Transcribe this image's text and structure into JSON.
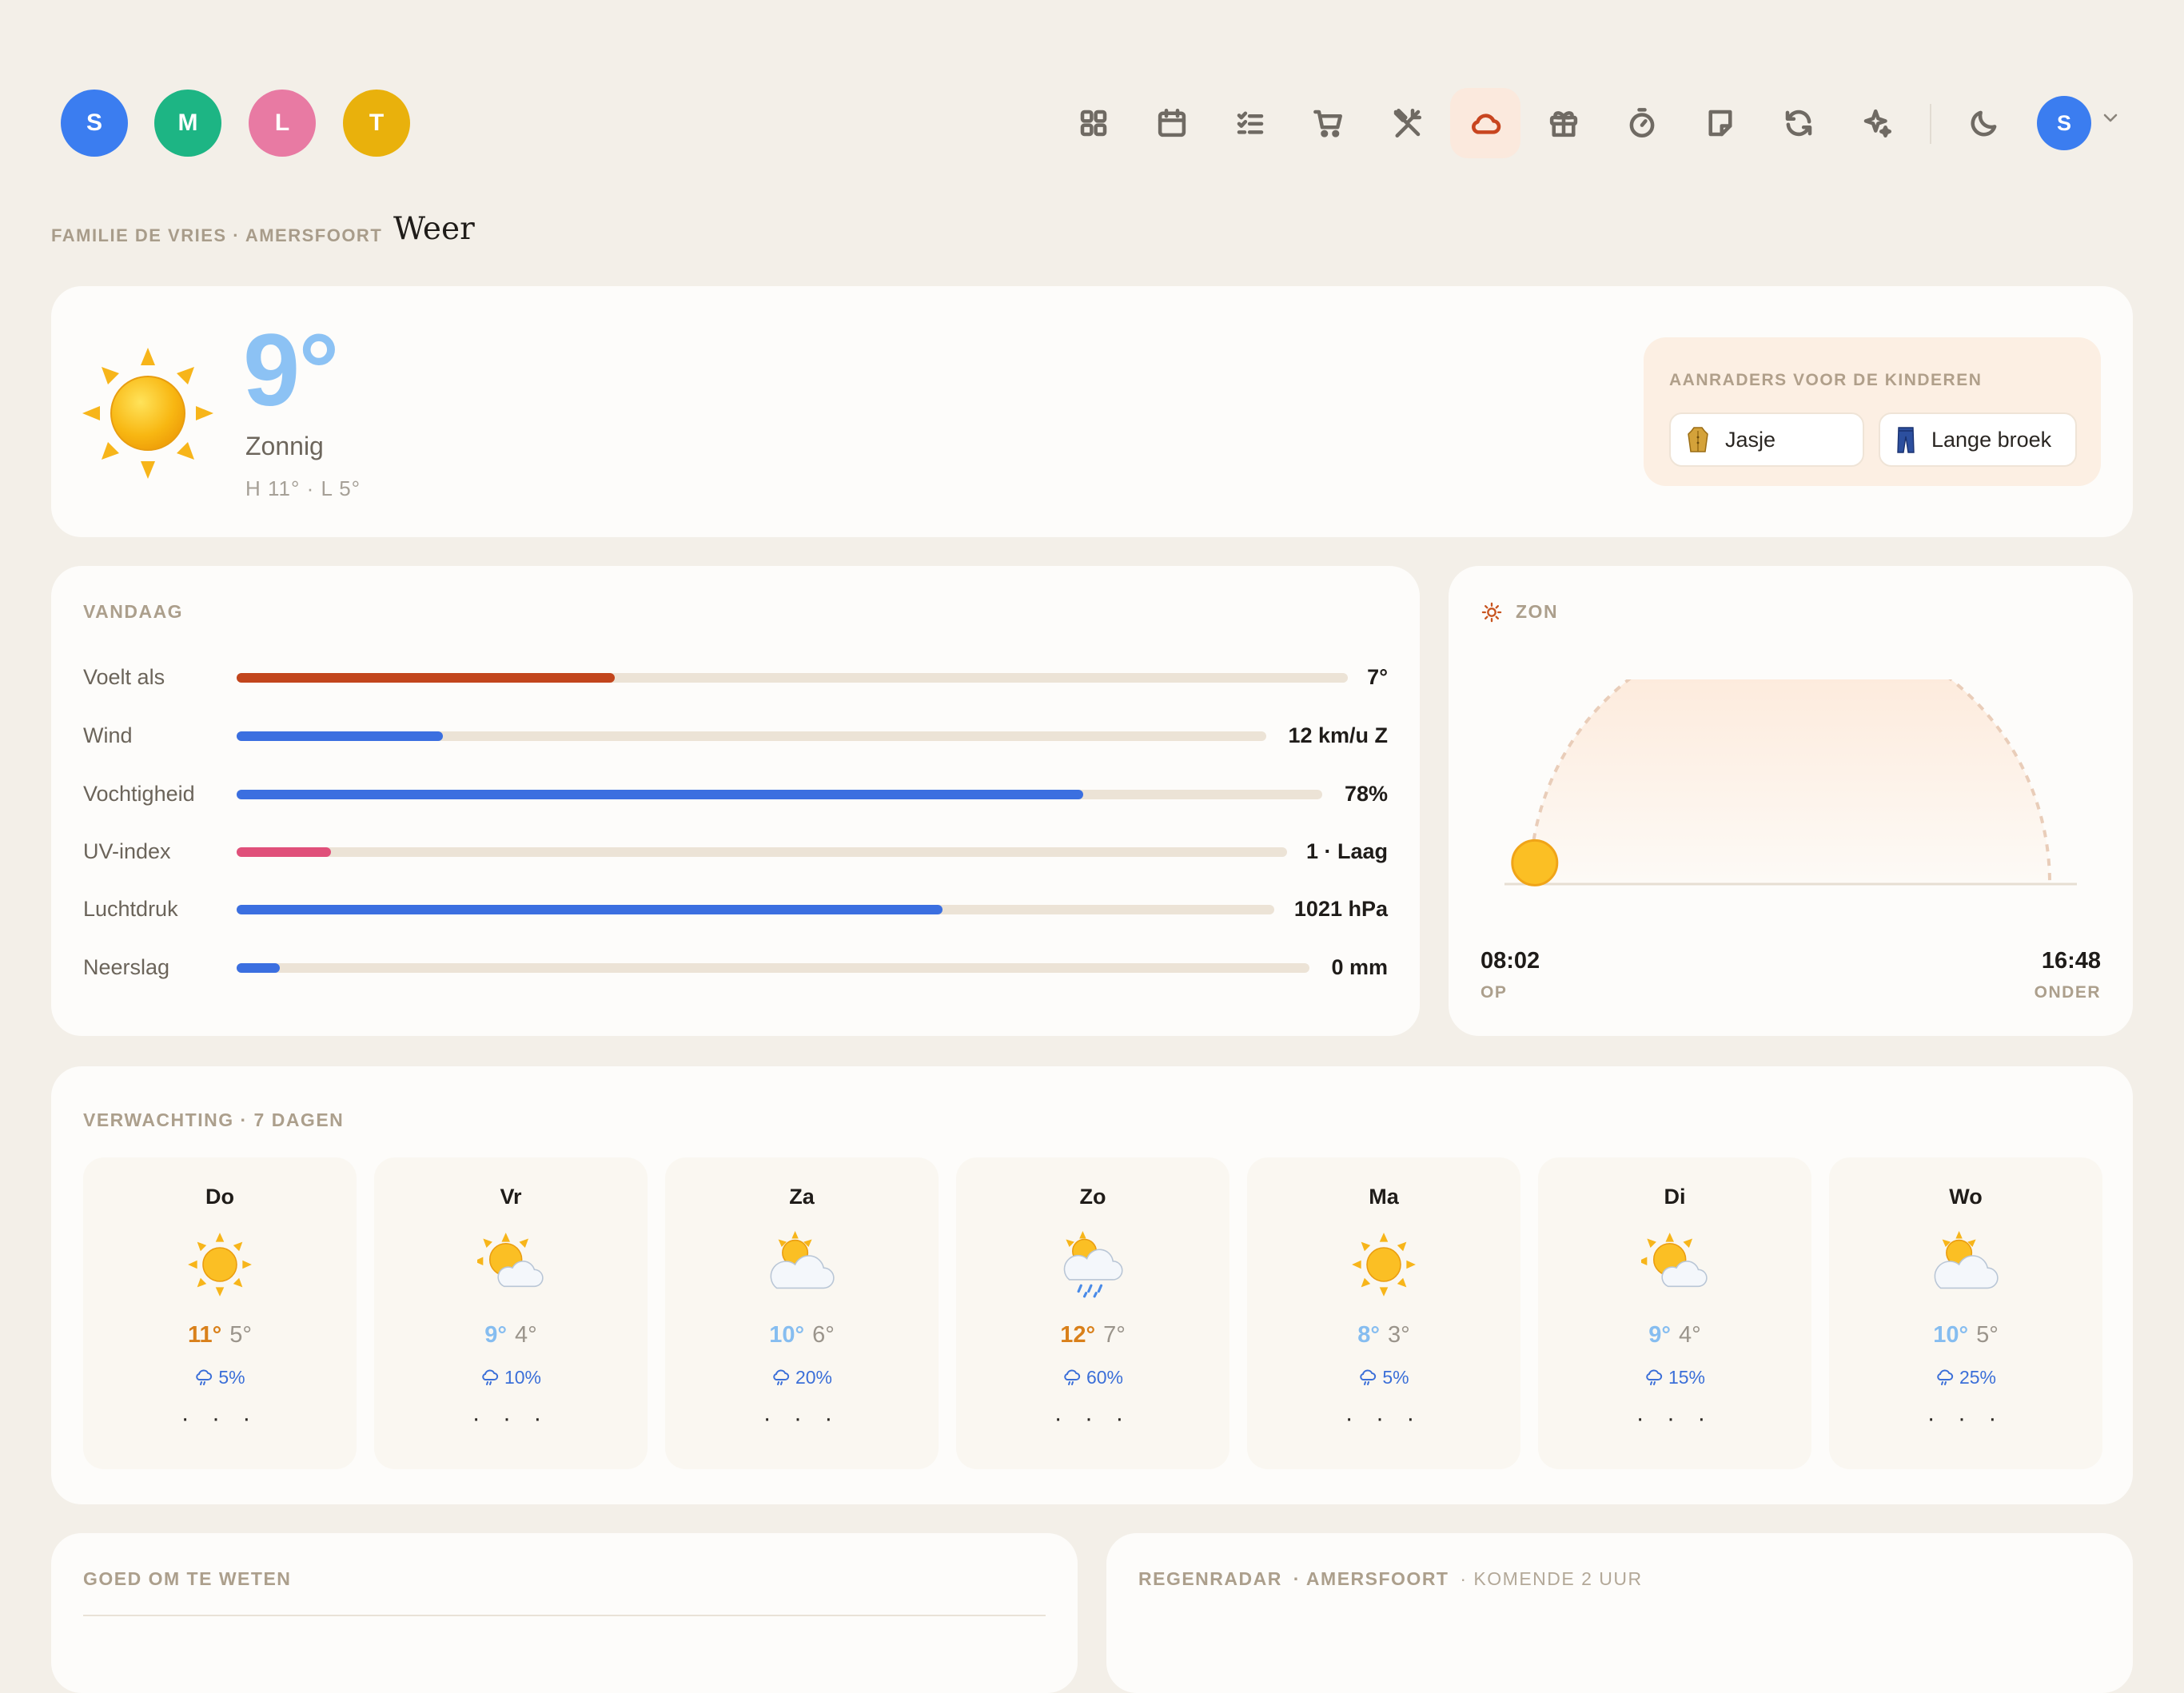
{
  "members": [
    {
      "initial": "S",
      "color": "#3b7df0"
    },
    {
      "initial": "M",
      "color": "#1db584"
    },
    {
      "initial": "L",
      "color": "#e87aa3"
    },
    {
      "initial": "T",
      "color": "#e9b10c"
    }
  ],
  "nav": [
    "grid-icon",
    "calendar-icon",
    "checklist-icon",
    "cart-icon",
    "utensils-icon",
    "cloud-icon",
    "gift-icon",
    "timer-icon",
    "note-icon",
    "refresh-icon",
    "sparkle-icon",
    "moon-icon"
  ],
  "nav_active": "cloud-icon",
  "user": {
    "initial": "S"
  },
  "breadcrumb": "FAMILIE DE VRIES · AMERSFOORT",
  "page_title": "Weer",
  "current": {
    "temp": "9°",
    "condition": "Zonnig",
    "hilo": "H 11° · L 5°",
    "icon": "sun-icon"
  },
  "advice": {
    "title": "AANRADERS VOOR DE KINDEREN",
    "items": [
      {
        "label": "Jasje",
        "icon": "coat-icon"
      },
      {
        "label": "Lange broek",
        "icon": "trousers-icon"
      }
    ]
  },
  "today": {
    "title": "VANDAAG",
    "rows": [
      {
        "label": "Voelt als",
        "value": "7°",
        "fraction": 0.34,
        "color": "#c2451c"
      },
      {
        "label": "Wind",
        "value": "12 km/u Z",
        "fraction": 0.2,
        "color": "#3b6fe0"
      },
      {
        "label": "Vochtigheid",
        "value": "78%",
        "fraction": 0.78,
        "color": "#3b6fe0"
      },
      {
        "label": "UV-index",
        "value": "1 · Laag",
        "fraction": 0.09,
        "color": "#e0507a"
      },
      {
        "label": "Luchtdruk",
        "value": "1021 hPa",
        "fraction": 0.68,
        "color": "#3b6fe0"
      },
      {
        "label": "Neerslag",
        "value": "0 mm",
        "fraction": 0.04,
        "color": "#3b6fe0"
      }
    ]
  },
  "sun": {
    "title": "ZON",
    "sunrise": "08:02",
    "sunrise_label": "OP",
    "sunset": "16:48",
    "sunset_label": "ONDER",
    "progress": 0.06
  },
  "forecast": {
    "title": "VERWACHTING · 7 DAGEN",
    "days": [
      {
        "day": "Do",
        "icon": "sun",
        "hi": "11°",
        "lo": "5°",
        "rain": "5%",
        "hi_color": "#d9801a"
      },
      {
        "day": "Vr",
        "icon": "sun-cloud",
        "hi": "9°",
        "lo": "4°",
        "rain": "10%",
        "hi_color": "#86bdf0"
      },
      {
        "day": "Za",
        "icon": "cloud-sun",
        "hi": "10°",
        "lo": "6°",
        "rain": "20%",
        "hi_color": "#86bdf0"
      },
      {
        "day": "Zo",
        "icon": "rain",
        "hi": "12°",
        "lo": "7°",
        "rain": "60%",
        "hi_color": "#d9801a"
      },
      {
        "day": "Ma",
        "icon": "sun",
        "hi": "8°",
        "lo": "3°",
        "rain": "5%",
        "hi_color": "#86bdf0"
      },
      {
        "day": "Di",
        "icon": "sun-cloud",
        "hi": "9°",
        "lo": "4°",
        "rain": "15%",
        "hi_color": "#86bdf0"
      },
      {
        "day": "Wo",
        "icon": "cloud-sun",
        "hi": "10°",
        "lo": "5°",
        "rain": "25%",
        "hi_color": "#86bdf0"
      }
    ],
    "dots": "· · ·"
  },
  "goed": {
    "title": "GOED OM TE WETEN"
  },
  "radar": {
    "title": "REGENRADAR",
    "place": "· AMERSFOORT",
    "sub": "· KOMENDE 2 UUR"
  }
}
